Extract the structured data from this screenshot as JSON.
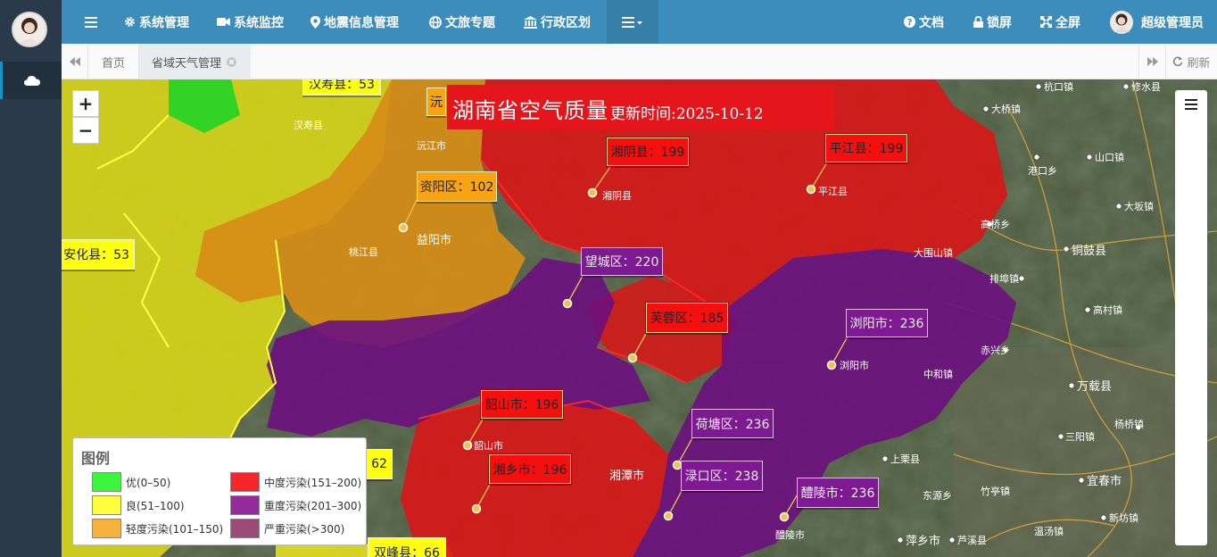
{
  "topnav": {
    "menu_items": [
      {
        "label": "系统管理",
        "icon": "gear-icon"
      },
      {
        "label": "系统监控",
        "icon": "video-camera-icon"
      },
      {
        "label": "地震信息管理",
        "icon": "map-pin-icon"
      },
      {
        "label": "文旅专题",
        "icon": "globe-icon"
      },
      {
        "label": "行政区划",
        "icon": "bank-icon"
      }
    ],
    "more_icon": "list-dropdown-icon",
    "docs_label": "文档",
    "lock_label": "锁屏",
    "fullscreen_label": "全屏",
    "user_label": "超级管理员"
  },
  "tabs": {
    "home_label": "首页",
    "active_label": "省域天气管理",
    "refresh_label": "刷新"
  },
  "map": {
    "title": "湖南省空气质量",
    "update_label": "更新时间:2025-10-12",
    "zoom_in": "+",
    "zoom_out": "−",
    "labels": [
      {
        "text": "汉寿县：53",
        "cls": "yellow"
      },
      {
        "text": "沅",
        "cls": "orange"
      },
      {
        "text": "湘阴县：199",
        "cls": "red"
      },
      {
        "text": "平江县：199",
        "cls": "red"
      },
      {
        "text": "资阳区：102",
        "cls": "orange"
      },
      {
        "text": "安化县：53",
        "cls": "yellow"
      },
      {
        "text": "望城区：220",
        "cls": "purple"
      },
      {
        "text": "芙蓉区：185",
        "cls": "red"
      },
      {
        "text": "浏阳市：236",
        "cls": "purple"
      },
      {
        "text": "韶山市：196",
        "cls": "red"
      },
      {
        "text": "荷塘区：236",
        "cls": "purple"
      },
      {
        "text": "62",
        "cls": "yellow"
      },
      {
        "text": "湘乡市：196",
        "cls": "red"
      },
      {
        "text": "渌口区：238",
        "cls": "purple"
      },
      {
        "text": "醴陵市：236",
        "cls": "purple"
      },
      {
        "text": "双峰县：66",
        "cls": "yellow"
      }
    ],
    "places": [
      "杭口镇",
      "修水县",
      "大桥镇",
      "港口乡",
      "山口镇",
      "大坂镇",
      "高桥乡",
      "铜鼓县",
      "排埠镇",
      "高村镇",
      "赤兴乡",
      "万载县",
      "三阳镇",
      "杨桥镇",
      "宜春市",
      "上栗县",
      "东源乡",
      "竹亭镇",
      "新坊镇",
      "萍乡市",
      "芦溪县",
      "温汤镇",
      "益阳市",
      "桃江县",
      "汉寿县",
      "沅江市",
      "湘阴县",
      "平江县",
      "大围山镇",
      "中和镇",
      "浏阳市",
      "醴陵市",
      "湘潭市",
      "韶山市"
    ]
  },
  "legend": {
    "title": "图例",
    "items": [
      {
        "label": "优(0–50)",
        "color": "#3cf53c"
      },
      {
        "label": "中度污染(151–200)",
        "color": "#f5262b"
      },
      {
        "label": "良(51–100)",
        "color": "#ffff3c"
      },
      {
        "label": "重度污染(201–300)",
        "color": "#952a9c"
      },
      {
        "label": "轻度污染(101–150)",
        "color": "#f5b23c"
      },
      {
        "label": "严重污染(>300)",
        "color": "#9c4a77"
      }
    ]
  }
}
